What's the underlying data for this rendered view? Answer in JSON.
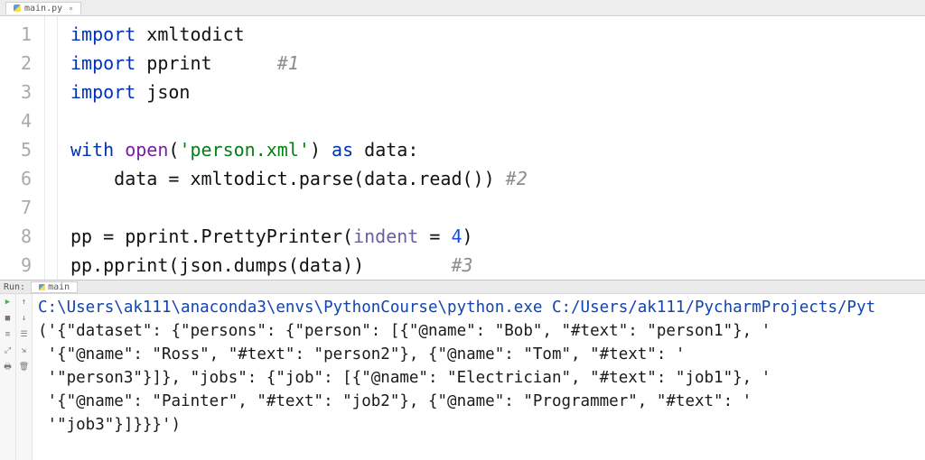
{
  "tab": {
    "filename": "main.py"
  },
  "code": {
    "lines": [
      "1",
      "2",
      "3",
      "4",
      "5",
      "6",
      "7",
      "8",
      "9"
    ],
    "l1": {
      "kw": "import",
      "mod": "xmltodict"
    },
    "l2": {
      "kw": "import",
      "mod": "pprint",
      "comment": "#1"
    },
    "l3": {
      "kw": "import",
      "mod": "json"
    },
    "l5": {
      "kw1": "with",
      "fn": "open",
      "paren1": "(",
      "str": "'person.xml'",
      "paren2": ") ",
      "kw2": "as",
      "var": " data:"
    },
    "l6": {
      "indent": "    ",
      "lhs": "data = xmltodict.parse(data.read()) ",
      "comment": "#2"
    },
    "l8": {
      "lhs": "pp = pprint.PrettyPrinter(",
      "param": "indent",
      "eq": " = ",
      "num": "4",
      "close": ")"
    },
    "l9": {
      "text": "pp.pprint(json.dumps(data))        ",
      "comment": "#3"
    }
  },
  "run": {
    "label": "Run:",
    "tab": "main"
  },
  "console": {
    "cmd": "C:\\Users\\ak111\\anaconda3\\envs\\PythonCourse\\python.exe C:/Users/ak111/PycharmProjects/Pyt",
    "out": "('{\"dataset\": {\"persons\": {\"person\": [{\"@name\": \"Bob\", \"#text\": \"person1\"}, '\n '{\"@name\": \"Ross\", \"#text\": \"person2\"}, {\"@name\": \"Tom\", \"#text\": '\n '\"person3\"}]}, \"jobs\": {\"job\": [{\"@name\": \"Electrician\", \"#text\": \"job1\"}, '\n '{\"@name\": \"Painter\", \"#text\": \"job2\"}, {\"@name\": \"Programmer\", \"#text\": '\n '\"job3\"}]}}}')"
  }
}
